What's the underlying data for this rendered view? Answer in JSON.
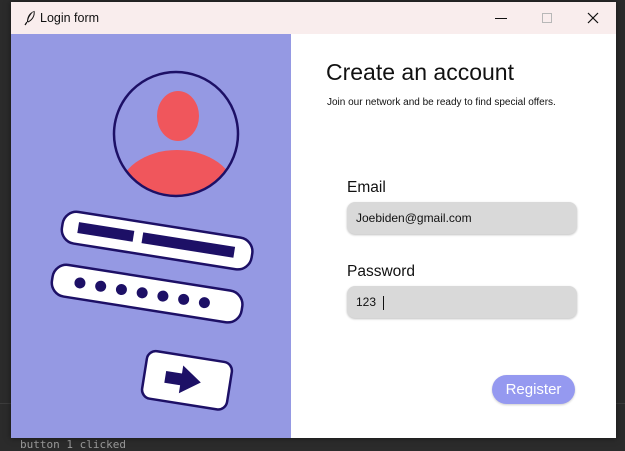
{
  "window": {
    "title": "Login form"
  },
  "controls": {
    "minimize_icon": "minimize-icon",
    "maximize_icon": "maximize-icon",
    "close_icon": "close-icon"
  },
  "background": {
    "status_text": "button 1 clicked"
  },
  "illustration": {
    "icon": "user-profile-login-illustration",
    "color_bg": "#9599e3",
    "color_dark": "#1d1066",
    "color_accent": "#f0565c"
  },
  "form": {
    "heading": "Create an account",
    "subheading": "Join our network and be ready to find special offers.",
    "email_label": "Email",
    "email_value": "Joebiden@gmail.com",
    "password_label": "Password",
    "password_value": "123",
    "register_label": "Register"
  },
  "colors": {
    "accent": "#9599f0",
    "input_bg": "#d9d9d9",
    "titlebar": "#f9eded"
  }
}
